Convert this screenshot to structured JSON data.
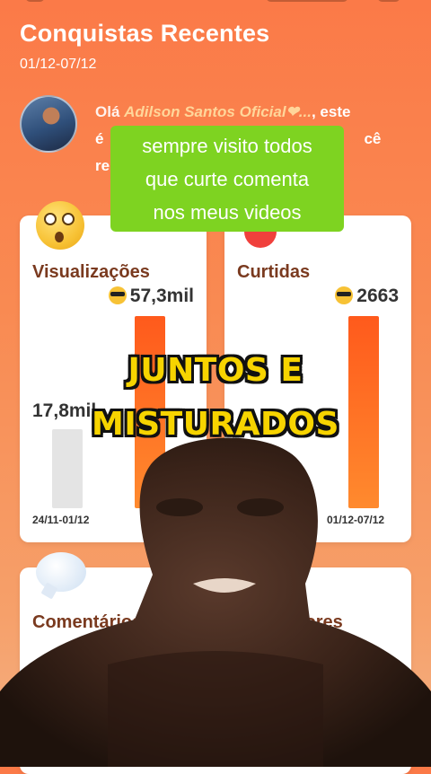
{
  "header": {
    "title": "Conquistas Recentes",
    "period": "01/12-07/12"
  },
  "greeting": {
    "prefix": "Olá",
    "name": "Adilson Santos Oficial❤...",
    "suffix": ", este",
    "line2_start": "é",
    "line2_end": "cê",
    "line3_start": "re"
  },
  "caption": {
    "lines": [
      "sempre visito todos",
      "que curte comenta",
      "nos meus videos"
    ],
    "color": "#7ed321"
  },
  "overlay": {
    "line1": "JUNTOS E",
    "line2": "MISTURADOS",
    "color": "#f7d400"
  },
  "cards": {
    "views": {
      "label": "Visualizações",
      "current": "57,3mil",
      "previous": "17,8mil",
      "previous_period": "24/11-01/12",
      "current_period_partial": "0",
      "current_fraction": 1.0,
      "previous_fraction": 0.31
    },
    "likes": {
      "label": "Curtidas",
      "current": "2663",
      "current_period": "01/12-07/12",
      "current_fraction": 1.0
    },
    "comments": {
      "label": "Comentários",
      "partial_label": "Co"
    },
    "followers": {
      "label": "lores"
    }
  },
  "icons": {
    "views": "dizzy-face-icon",
    "likes": "heart-icon",
    "comments": "speech-bubble-icon",
    "value": "cool-sunglasses-icon"
  },
  "colors": {
    "accent": "#ff5a1c",
    "text_title": "#ffffff"
  }
}
